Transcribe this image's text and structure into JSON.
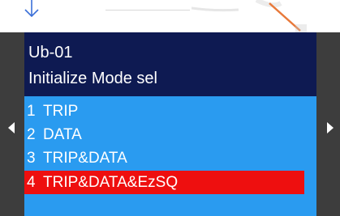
{
  "screen": {
    "param_code": "Ub-01",
    "title": "Initialize Mode sel",
    "options": [
      {
        "number": "1",
        "label": "TRIP",
        "selected": false
      },
      {
        "number": "2",
        "label": "DATA",
        "selected": false
      },
      {
        "number": "3",
        "label": "TRIP&DATA",
        "selected": false
      },
      {
        "number": "4",
        "label": "TRIP&DATA&EzSQ",
        "selected": true
      }
    ]
  },
  "colors": {
    "header_bg": "#0e1a52",
    "screen_bg": "#2a9bf0",
    "selected_bg": "#ee0f0f",
    "frame": "#3d3d3d",
    "indicator_arrow": "#3a6fd8",
    "cable_accent": "#e8793a"
  },
  "icons": {
    "indicator": "down-arrow-icon",
    "scroll_left": "left-triangle-icon",
    "scroll_right": "right-triangle-icon"
  }
}
